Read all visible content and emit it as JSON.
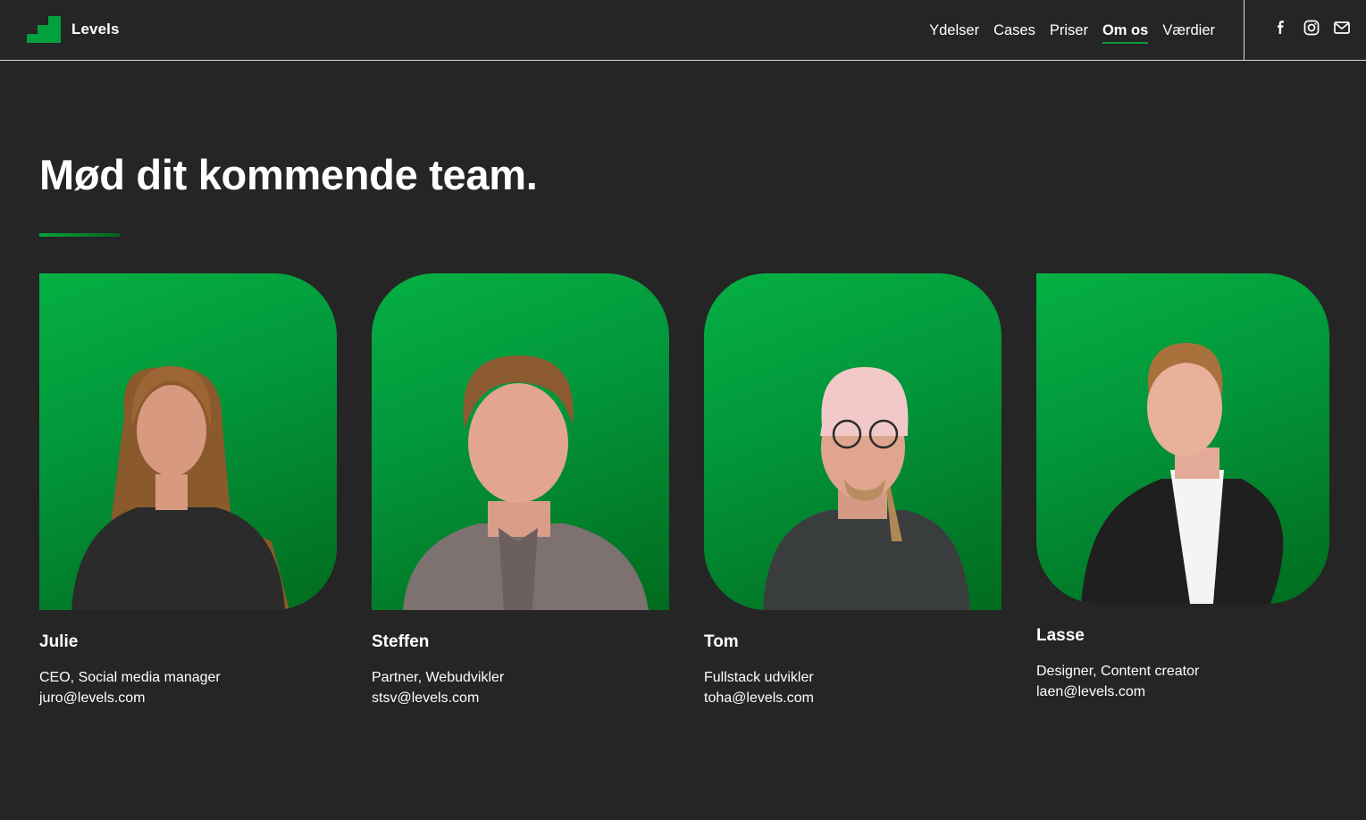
{
  "brand": {
    "name": "Levels",
    "accent": "#02a03e",
    "background": "#252525"
  },
  "nav": {
    "items": [
      {
        "label": "Ydelser",
        "active": false
      },
      {
        "label": "Cases",
        "active": false
      },
      {
        "label": "Priser",
        "active": false
      },
      {
        "label": "Om os",
        "active": true
      },
      {
        "label": "Værdier",
        "active": false
      }
    ]
  },
  "social": [
    "facebook-icon",
    "instagram-icon",
    "mail-icon"
  ],
  "page": {
    "heading": "Mød dit kommende team."
  },
  "team": [
    {
      "name": "Julie",
      "role": "CEO, Social media manager",
      "email": "juro@levels.com"
    },
    {
      "name": "Steffen",
      "role": "Partner, Webudvikler",
      "email": "stsv@levels.com"
    },
    {
      "name": "Tom",
      "role": "Fullstack udvikler",
      "email": "toha@levels.com"
    },
    {
      "name": "Lasse",
      "role": "Designer, Content creator",
      "email": "laen@levels.com"
    }
  ]
}
